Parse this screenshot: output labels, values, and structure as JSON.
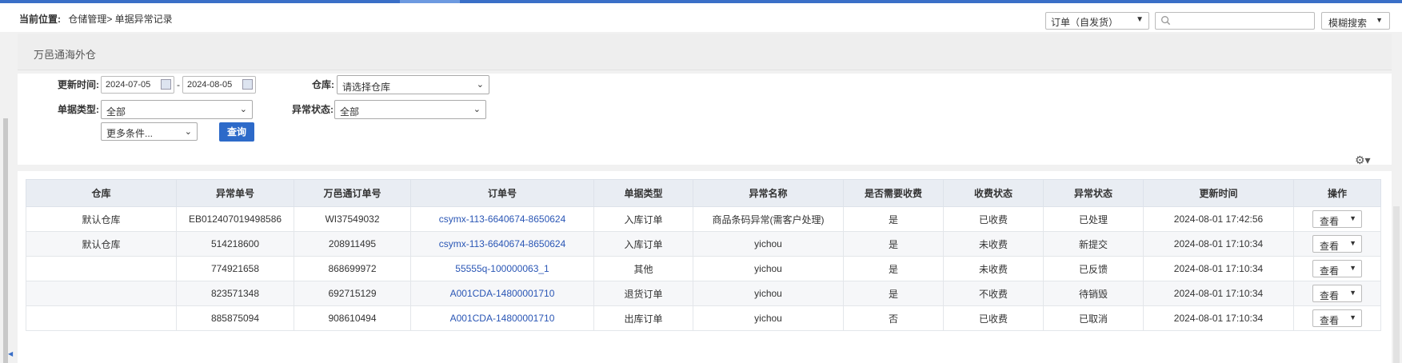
{
  "breadcrumb": {
    "label": "当前位置:",
    "path": "仓储管理> 单据异常记录"
  },
  "header": {
    "order_type_select": "订单（自发货）",
    "search_placeholder": "",
    "fuzzy_search_label": "模糊搜索"
  },
  "panel": {
    "title": "万邑通海外仓"
  },
  "filters": {
    "update_time_label": "更新时间:",
    "date_from": "2024-07-05",
    "date_to": "2024-08-05",
    "date_sep": "-",
    "warehouse_label": "仓库:",
    "warehouse_value": "请选择仓库",
    "doc_type_label": "单据类型:",
    "doc_type_value": "全部",
    "exception_status_label": "异常状态:",
    "exception_status_value": "全部",
    "more_conditions": "更多条件...",
    "query_label": "查询"
  },
  "table": {
    "columns": [
      "仓库",
      "异常单号",
      "万邑通订单号",
      "订单号",
      "单据类型",
      "异常名称",
      "是否需要收费",
      "收费状态",
      "异常状态",
      "更新时间",
      "操作"
    ],
    "rows": [
      {
        "warehouse": "默认仓库",
        "exception_no": "EB012407019498586",
        "wyt_order_no": "WI37549032",
        "order_no": "csymx-113-6640674-8650624",
        "doc_type": "入库订单",
        "exception_name": "商品条码异常(需客户处理)",
        "need_fee": "是",
        "fee_status": "已收费",
        "exception_status": "已处理",
        "updated": "2024-08-01 17:42:56",
        "action": "查看"
      },
      {
        "warehouse": "默认仓库",
        "exception_no": "514218600",
        "wyt_order_no": "208911495",
        "order_no": "csymx-113-6640674-8650624",
        "doc_type": "入库订单",
        "exception_name": "yichou",
        "need_fee": "是",
        "fee_status": "未收费",
        "exception_status": "新提交",
        "updated": "2024-08-01 17:10:34",
        "action": "查看"
      },
      {
        "warehouse": "",
        "exception_no": "774921658",
        "wyt_order_no": "868699972",
        "order_no": "55555q-100000063_1",
        "doc_type": "其他",
        "exception_name": "yichou",
        "need_fee": "是",
        "fee_status": "未收费",
        "exception_status": "已反馈",
        "updated": "2024-08-01 17:10:34",
        "action": "查看"
      },
      {
        "warehouse": "",
        "exception_no": "823571348",
        "wyt_order_no": "692715129",
        "order_no": "A001CDA-14800001710",
        "doc_type": "退货订单",
        "exception_name": "yichou",
        "need_fee": "是",
        "fee_status": "不收费",
        "exception_status": "待销毁",
        "updated": "2024-08-01 17:10:34",
        "action": "查看"
      },
      {
        "warehouse": "",
        "exception_no": "885875094",
        "wyt_order_no": "908610494",
        "order_no": "A001CDA-14800001710",
        "doc_type": "出库订单",
        "exception_name": "yichou",
        "need_fee": "否",
        "fee_status": "已收费",
        "exception_status": "已取消",
        "updated": "2024-08-01 17:10:34",
        "action": "查看"
      }
    ]
  },
  "colors": {
    "accent": "#2d6ac9",
    "link": "#2a56b5",
    "topbar": "#3a6fc7"
  },
  "icons": [
    "search-icon",
    "calendar-icon",
    "chevron-down-icon",
    "settings-gear-icon"
  ]
}
